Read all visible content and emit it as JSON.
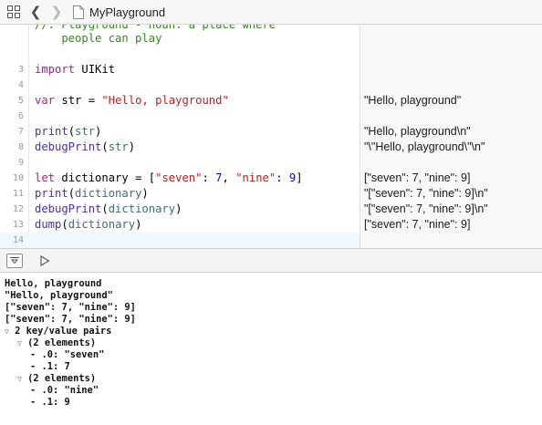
{
  "jumpbar": {
    "title": "MyPlayground",
    "icons": [
      "grid-icon",
      "chevron-left-icon",
      "chevron-right-icon",
      "swift-file-icon"
    ]
  },
  "editor": {
    "comment_line1": "//: Playground - noun: a place where",
    "comment_line2": "    people can play",
    "line_numbers": [
      "3",
      "4",
      "5",
      "6",
      "7",
      "8",
      "9",
      "10",
      "11",
      "12",
      "13",
      "14"
    ],
    "kw_import": "import",
    "mod_uikit": "UIKit",
    "kw_var": "var",
    "var_str": "str",
    "op_eq": "=",
    "str_hello": "\"Hello, playground\"",
    "fn_print": "print",
    "fn_debugprint": "debugPrint",
    "fn_dump": "dump",
    "arg_str": "str",
    "kw_let": "let",
    "var_dictionary": "dictionary",
    "arg_dictionary": "dictionary",
    "str_seven": "\"seven\"",
    "str_nine": "\"nine\"",
    "num_seven": "7",
    "num_nine": "9"
  },
  "results": {
    "line5": "\"Hello, playground\"",
    "line7": "\"Hello, playground\\n\"",
    "line8": "\"\\\"Hello, playground\\\"\\n\"",
    "line10": "[\"seven\": 7, \"nine\": 9]",
    "line11": "\"[\"seven\": 7, \"nine\": 9]\\n\"",
    "line12": "\"[\"seven\": 7, \"nine\": 9]\\n\"",
    "line13": "[\"seven\": 7, \"nine\": 9]"
  },
  "debugbar": {
    "icons": [
      "hide-debug-area-icon",
      "run-playground-icon"
    ]
  },
  "console": {
    "lines": [
      "Hello, playground",
      "\"Hello, playground\"",
      "[\"seven\": 7, \"nine\": 9]",
      "[\"seven\": 7, \"nine\": 9]",
      "2 key/value pairs",
      "(2 elements)",
      "- .0: \"seven\"",
      "- .1: 7",
      "(2 elements)",
      "- .0: \"nine\"",
      "- .1: 9"
    ]
  },
  "colors": {
    "comment": "#2f8a1a",
    "keyword": "#aa1f86",
    "string": "#c41a16",
    "number": "#1c00cf",
    "function": "#4b2fa2",
    "identifier": "#3f6e74",
    "current_line": "#f1f7fe"
  }
}
